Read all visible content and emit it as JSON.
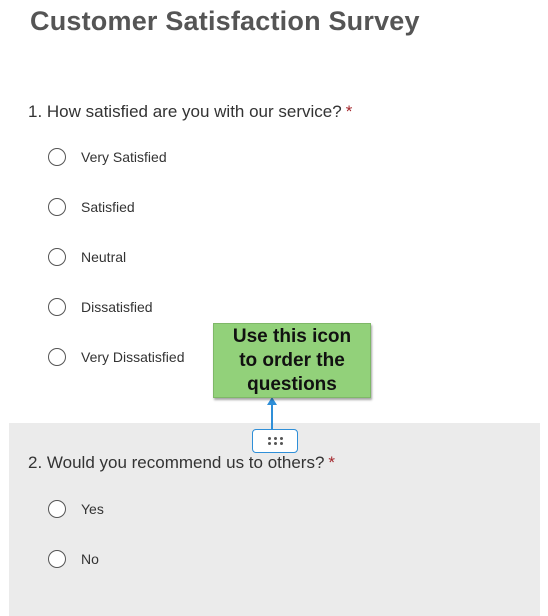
{
  "survey": {
    "title": "Customer Satisfaction Survey"
  },
  "questions": [
    {
      "text": "1. How satisfied are you with our service?",
      "required_marker": "*",
      "options": [
        "Very Satisfied",
        "Satisfied",
        "Neutral",
        "Dissatisfied",
        "Very Dissatisfied"
      ]
    },
    {
      "text": "2. Would you recommend us to others?",
      "required_marker": "*",
      "options": [
        "Yes",
        "No"
      ]
    }
  ],
  "callout": {
    "lines": [
      "Use this icon",
      "to order the",
      "questions"
    ],
    "background": "#92d17a"
  },
  "drag_handle": {
    "icon": "drag-handle-icon",
    "border_color": "#2f8fd8"
  },
  "colors": {
    "required": "#a4262c",
    "selected_question_bg": "#ebebeb",
    "arrow": "#2f8fd8"
  }
}
